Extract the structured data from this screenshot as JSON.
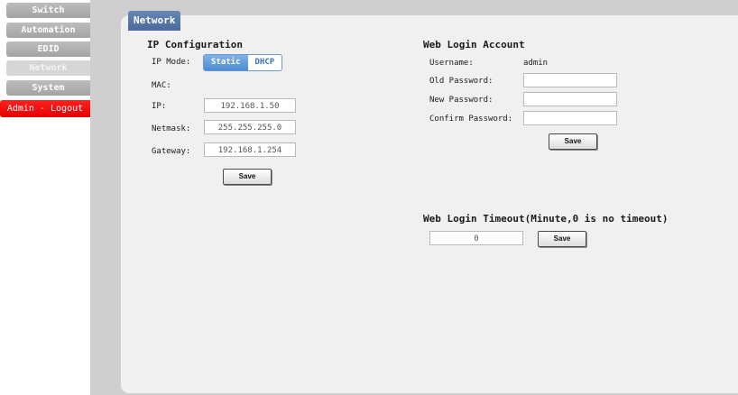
{
  "nav": {
    "items": [
      {
        "label": "Switch"
      },
      {
        "label": "Automation"
      },
      {
        "label": "EDID"
      },
      {
        "label": "Network"
      },
      {
        "label": "System"
      }
    ],
    "logout": "Admin - Logout"
  },
  "panel": {
    "title": "Network"
  },
  "ip_config": {
    "title": "IP Configuration",
    "mode_label": "IP Mode:",
    "mode_options": [
      "Static",
      "DHCP"
    ],
    "mode_selected": "Static",
    "mac_label": "MAC:",
    "mac_value": "",
    "ip_label": "IP:",
    "ip_value": "192.168.1.50",
    "netmask_label": "Netmask:",
    "netmask_value": "255.255.255.0",
    "gateway_label": "Gateway:",
    "gateway_value": "192.168.1.254",
    "save": "Save"
  },
  "web_login": {
    "title": "Web Login Account",
    "username_label": "Username:",
    "username_value": "admin",
    "old_password_label": "Old Password:",
    "new_password_label": "New Password:",
    "confirm_password_label": "Confirm Password:",
    "save": "Save"
  },
  "timeout": {
    "title": "Web Login Timeout(Minute,0 is no timeout)",
    "value": "0",
    "save": "Save"
  },
  "colors": {
    "accent_blue": "#4c8bd6",
    "logout_red": "#e60000",
    "tab_blue": "#4b6a9c"
  }
}
